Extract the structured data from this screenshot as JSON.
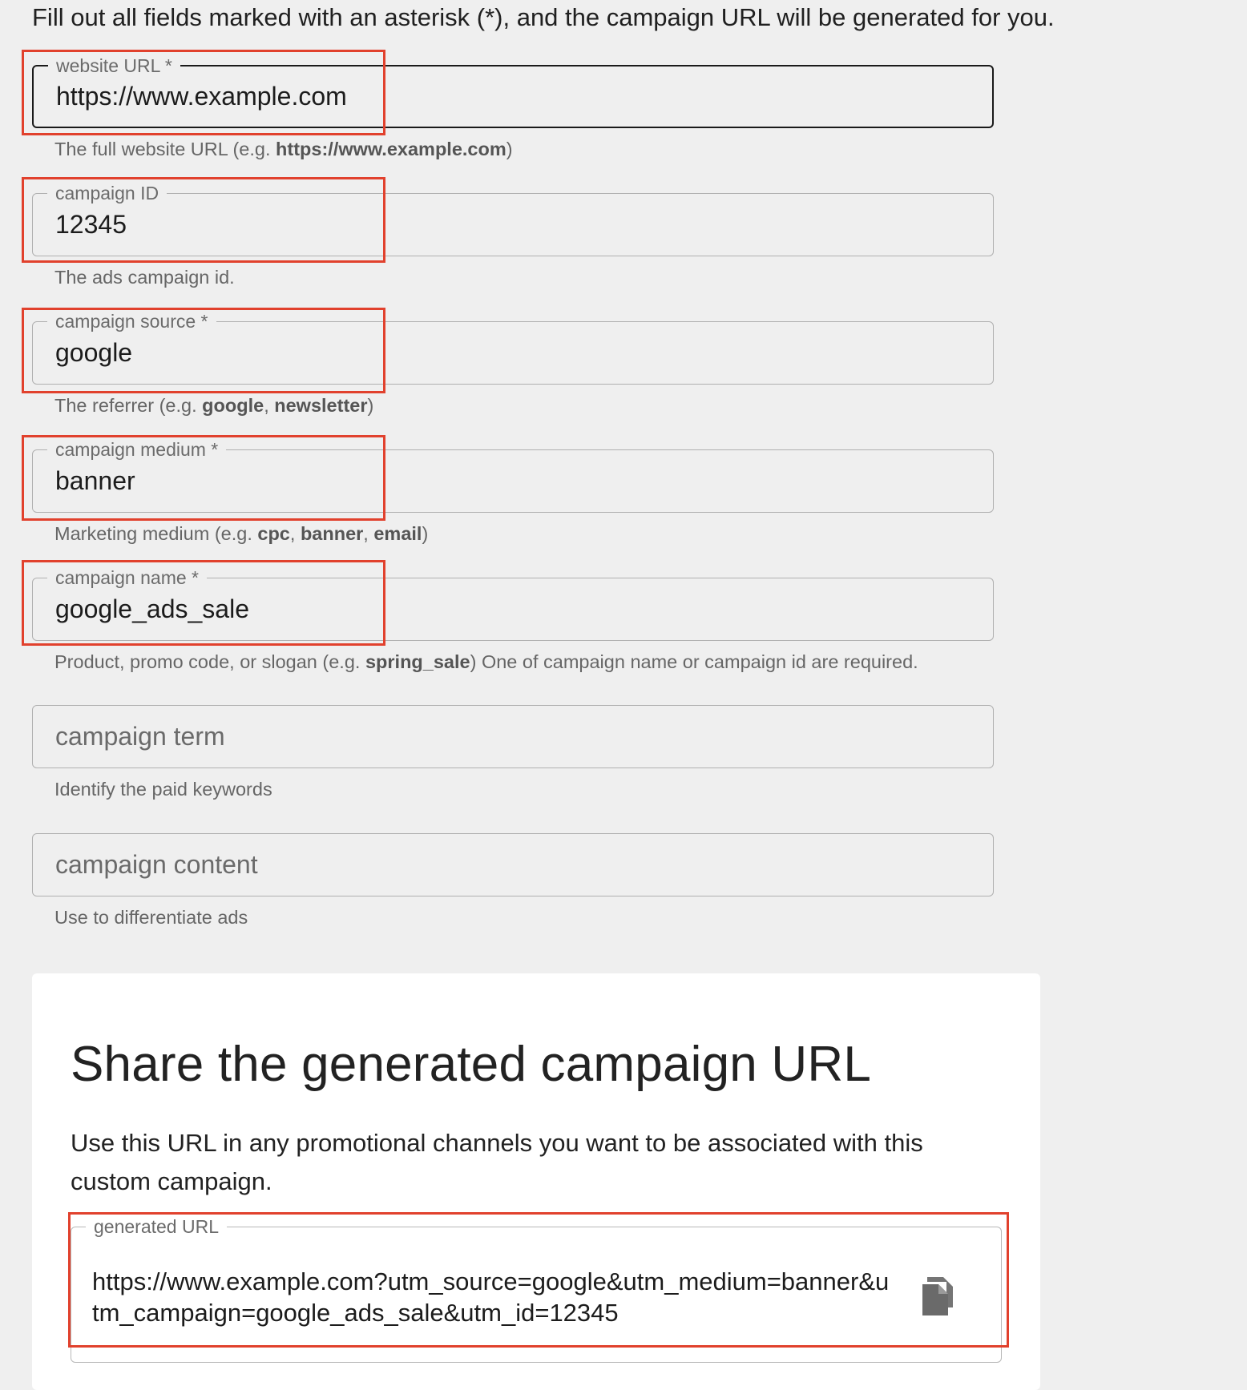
{
  "intro": "Fill out all fields marked with an asterisk (*), and the campaign URL will be generated for you.",
  "fields": {
    "website_url": {
      "label": "website URL *",
      "value": "https://www.example.com",
      "helper_prefix": "The full website URL (e.g. ",
      "helper_bold": "https://www.example.com",
      "helper_suffix": ")"
    },
    "campaign_id": {
      "label": "campaign ID",
      "value": "12345",
      "helper": "The ads campaign id."
    },
    "campaign_source": {
      "label": "campaign source *",
      "value": "google",
      "helper_prefix": "The referrer (e.g. ",
      "helper_bold1": "google",
      "helper_sep": ", ",
      "helper_bold2": "newsletter",
      "helper_suffix": ")"
    },
    "campaign_medium": {
      "label": "campaign medium *",
      "value": "banner",
      "helper_prefix": "Marketing medium (e.g. ",
      "helper_bold1": "cpc",
      "helper_sep1": ", ",
      "helper_bold2": "banner",
      "helper_sep2": ", ",
      "helper_bold3": "email",
      "helper_suffix": ")"
    },
    "campaign_name": {
      "label": "campaign name *",
      "value": "google_ads_sale",
      "helper_prefix": "Product, promo code, or slogan (e.g. ",
      "helper_bold": "spring_sale",
      "helper_suffix": ") One of campaign name or campaign id are required."
    },
    "campaign_term": {
      "placeholder": "campaign term",
      "helper": "Identify the paid keywords"
    },
    "campaign_content": {
      "placeholder": "campaign content",
      "helper": "Use to differentiate ads"
    }
  },
  "share_card": {
    "title": "Share the generated campaign URL",
    "description": "Use this URL in any promotional channels you want to be associated with this custom campaign.",
    "url_label": "generated URL",
    "url_value": "https://www.example.com?utm_source=google&utm_medium=banner&utm_campaign=google_ads_sale&utm_id=12345",
    "copy_icon": "copy-icon"
  },
  "colors": {
    "highlight": "#e1412d",
    "background": "#efefef",
    "card": "#ffffff"
  }
}
